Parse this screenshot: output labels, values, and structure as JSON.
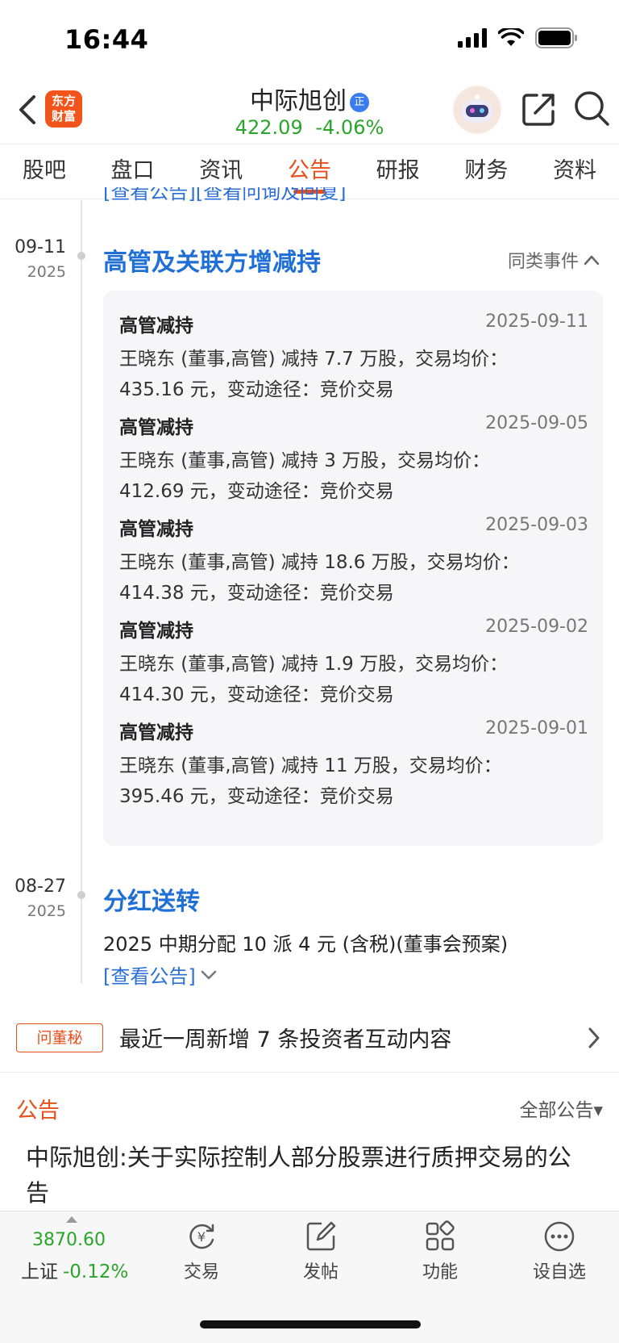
{
  "status_bar": {
    "time": "16:44"
  },
  "header": {
    "brand_logo_line1": "东方",
    "brand_logo_line2": "财富",
    "stock_name": "中际旭创",
    "stock_badge": "正",
    "price": "422.09",
    "change_pct": "-4.06%"
  },
  "tabs": [
    {
      "label": "股吧",
      "active": false
    },
    {
      "label": "盘口",
      "active": false
    },
    {
      "label": "资讯",
      "active": false
    },
    {
      "label": "公告",
      "active": true
    },
    {
      "label": "研报",
      "active": false
    },
    {
      "label": "财务",
      "active": false
    },
    {
      "label": "资料",
      "active": false
    }
  ],
  "timeline": {
    "clipped_link": "[查看公告][查看问询及回复]",
    "event1": {
      "date": "09-11",
      "year": "2025",
      "title": "高管及关联方增减持",
      "similar_link": "同类事件",
      "items": [
        {
          "type": "高管减持",
          "date": "2025-09-11",
          "desc_line1": "王晓东 (董事,高管) 减持 7.7 万股，交易均价：",
          "desc_line2": "435.16 元，变动途径：竞价交易"
        },
        {
          "type": "高管减持",
          "date": "2025-09-05",
          "desc_line1": "王晓东 (董事,高管) 减持 3 万股，交易均价：",
          "desc_line2": "412.69 元，变动途径：竞价交易"
        },
        {
          "type": "高管减持",
          "date": "2025-09-03",
          "desc_line1": "王晓东 (董事,高管) 减持 18.6 万股，交易均价：",
          "desc_line2": "414.38 元，变动途径：竞价交易"
        },
        {
          "type": "高管减持",
          "date": "2025-09-02",
          "desc_line1": "王晓东 (董事,高管) 减持 1.9 万股，交易均价：",
          "desc_line2": "414.30 元，变动途径：竞价交易"
        },
        {
          "type": "高管减持",
          "date": "2025-09-01",
          "desc_line1": "王晓东 (董事,高管) 减持 11 万股，交易均价：",
          "desc_line2": "395.46 元，变动途径：竞价交易"
        }
      ]
    },
    "event2": {
      "date": "08-27",
      "year": "2025",
      "title": "分红送转",
      "desc": "2025 中期分配 10 派 4 元 (含税)(董事会预案)",
      "view_link": "[查看公告]"
    }
  },
  "interaction": {
    "badge": "问董秘",
    "text": "最近一周新增 7 条投资者互动内容"
  },
  "announcements": {
    "section_title": "公告",
    "filter": "全部公告▾",
    "first_title": "中际旭创:关于实际控制人部分股票进行质押交易的公告"
  },
  "bottom_bar": {
    "index_value": "3870.60",
    "index_name": "上证",
    "index_change": "-0.12%",
    "nav": [
      {
        "label": "交易",
        "icon": "trade-icon"
      },
      {
        "label": "发帖",
        "icon": "post-icon"
      },
      {
        "label": "功能",
        "icon": "function-icon"
      },
      {
        "label": "设自选",
        "icon": "more-icon"
      }
    ]
  }
}
